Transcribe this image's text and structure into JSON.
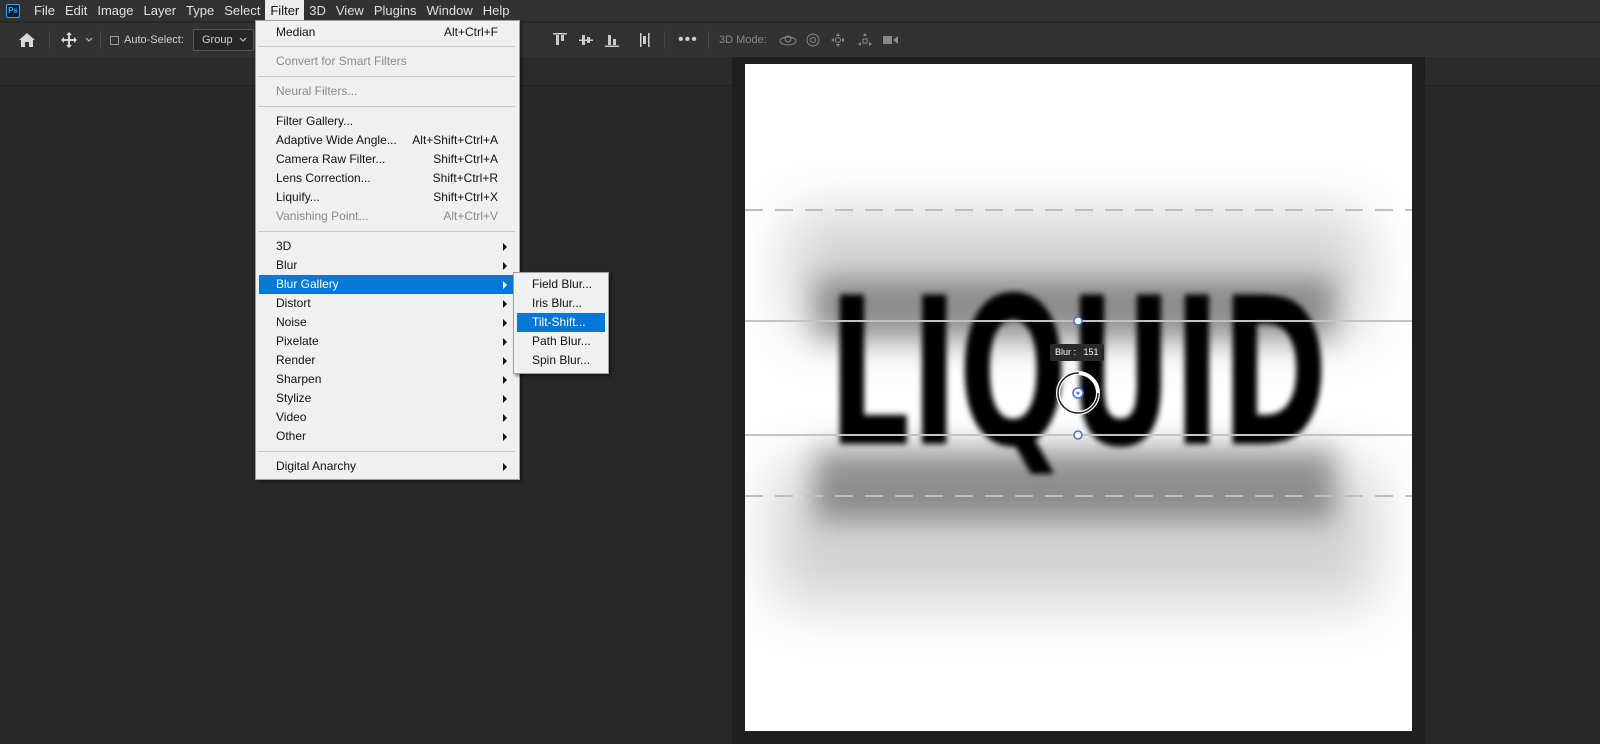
{
  "app": {
    "logo": "Ps"
  },
  "menubar": {
    "items": [
      {
        "label": "File"
      },
      {
        "label": "Edit"
      },
      {
        "label": "Image"
      },
      {
        "label": "Layer"
      },
      {
        "label": "Type"
      },
      {
        "label": "Select"
      },
      {
        "label": "Filter"
      },
      {
        "label": "3D"
      },
      {
        "label": "View"
      },
      {
        "label": "Plugins"
      },
      {
        "label": "Window"
      },
      {
        "label": "Help"
      }
    ],
    "active": "Filter"
  },
  "options": {
    "auto_select_label": "Auto-Select:",
    "group_value": "Group",
    "mode_3d_label": "3D Mode:"
  },
  "filter_menu": {
    "items": [
      {
        "label": "Median",
        "shortcut": "Alt+Ctrl+F"
      },
      {
        "label": "Convert for Smart Filters"
      },
      {
        "label": "Neural Filters..."
      },
      {
        "label": "Filter Gallery..."
      },
      {
        "label": "Adaptive Wide Angle...",
        "shortcut": "Alt+Shift+Ctrl+A"
      },
      {
        "label": "Camera Raw Filter...",
        "shortcut": "Shift+Ctrl+A"
      },
      {
        "label": "Lens Correction...",
        "shortcut": "Shift+Ctrl+R"
      },
      {
        "label": "Liquify...",
        "shortcut": "Shift+Ctrl+X"
      },
      {
        "label": "Vanishing Point...",
        "shortcut": "Alt+Ctrl+V"
      },
      {
        "label": "3D"
      },
      {
        "label": "Blur"
      },
      {
        "label": "Blur Gallery"
      },
      {
        "label": "Distort"
      },
      {
        "label": "Noise"
      },
      {
        "label": "Pixelate"
      },
      {
        "label": "Render"
      },
      {
        "label": "Sharpen"
      },
      {
        "label": "Stylize"
      },
      {
        "label": "Video"
      },
      {
        "label": "Other"
      },
      {
        "label": "Digital Anarchy"
      }
    ]
  },
  "blur_gallery_submenu": {
    "items": [
      {
        "label": "Field Blur..."
      },
      {
        "label": "Iris Blur..."
      },
      {
        "label": "Tilt-Shift..."
      },
      {
        "label": "Path Blur..."
      },
      {
        "label": "Spin Blur..."
      }
    ],
    "highlighted": "Tilt-Shift..."
  },
  "canvas": {
    "text": "LIQUID",
    "blur_label": "Blur :",
    "blur_value": "151"
  },
  "colors": {
    "highlight": "#0078d7",
    "menu_bg": "#f0f0f0",
    "workspace": "#282828"
  },
  "icons": [
    "home-icon",
    "move-tool-icon",
    "chevron-down-icon",
    "align-top-icon",
    "align-middle-icon",
    "align-bottom-icon",
    "distribute-icon",
    "more-icon",
    "orbit-3d-icon",
    "roll-3d-icon",
    "pan-3d-icon",
    "slide-3d-icon",
    "scale-3d-icon"
  ]
}
